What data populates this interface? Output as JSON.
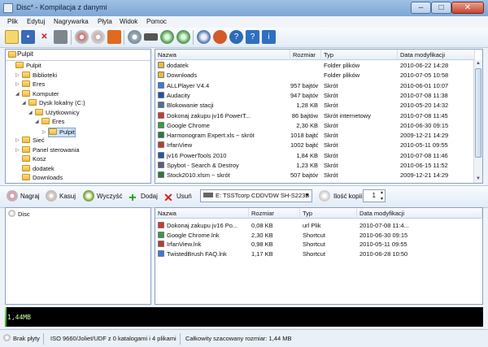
{
  "window": {
    "title": "Disc* - Kompilacja z danymi",
    "buttons": {
      "minimize": "–",
      "maximize": "□",
      "close": "✕"
    }
  },
  "menu": [
    "Plik",
    "Edytuj",
    "Nagrywarka",
    "Płyta",
    "Widok",
    "Pomoc"
  ],
  "toolbar": {
    "icons": [
      "new-icon",
      "save-icon",
      "delete-icon",
      "print-icon",
      "burn-icon",
      "copy-icon",
      "disc-icon",
      "drive-icon",
      "erase-icon",
      "disc2-icon",
      "settings-icon",
      "paint-icon",
      "help-circle-icon",
      "help-icon",
      "info-icon"
    ]
  },
  "tree": {
    "header": "Pulpit",
    "items": [
      {
        "label": "Pulpit",
        "exp": ""
      },
      {
        "label": "Biblioteki",
        "exp": "▷"
      },
      {
        "label": "Eres",
        "exp": "▷"
      },
      {
        "label": "Komputer",
        "exp": "◢"
      },
      {
        "label": "Dysk lokalny (C:)",
        "exp": "◢"
      },
      {
        "label": "Użytkownicy",
        "exp": "◢"
      },
      {
        "label": "Eres",
        "exp": "◢"
      },
      {
        "label": "Pulpit",
        "exp": "▷"
      },
      {
        "label": "Sieć",
        "exp": "▷"
      },
      {
        "label": "Panel sterowania",
        "exp": "▷"
      },
      {
        "label": "Kosz",
        "exp": ""
      },
      {
        "label": "dodatek",
        "exp": ""
      },
      {
        "label": "Downloads",
        "exp": ""
      }
    ]
  },
  "files": {
    "headers": {
      "name": "Nazwa",
      "size": "Rozmiar",
      "type": "Typ",
      "date": "Data modyfikacji"
    },
    "rows": [
      {
        "name": "dodatek",
        "size": "",
        "type": "Folder plików",
        "date": "2010-06-22 14:28",
        "color": "#f0b93e"
      },
      {
        "name": "Downloads",
        "size": "",
        "type": "Folder plików",
        "date": "2010-07-05 10:58",
        "color": "#f0b93e"
      },
      {
        "name": "ALLPlayer V4.4",
        "size": "957 bajtów",
        "type": "Skrót",
        "date": "2010-06-01 10:07",
        "color": "#3a7bd5"
      },
      {
        "name": "Audacity",
        "size": "947 bajtów",
        "type": "Skrót",
        "date": "2010-07-08 11:38",
        "color": "#1e50b0"
      },
      {
        "name": "Blokowanie stacji",
        "size": "1,28 KB",
        "type": "Skrót",
        "date": "2010-05-20 14:32",
        "color": "#4a6fa0"
      },
      {
        "name": "Dokonaj zakupu jv16 PowerT...",
        "size": "86 bajtów",
        "type": "Skrót internetowy",
        "date": "2010-07-08 11:45",
        "color": "#d03a2a"
      },
      {
        "name": "Google Chrome",
        "size": "2,30 KB",
        "type": "Skrót",
        "date": "2010-06-30 09:15",
        "color": "#2f9e44"
      },
      {
        "name": "Harmonogram Expert.xls ~ skrót",
        "size": "1018 bajtów",
        "type": "Skrót",
        "date": "2009-12-21 14:29",
        "color": "#2a7a3a"
      },
      {
        "name": "IrfanView",
        "size": "1002 bajtów",
        "type": "Skrót",
        "date": "2010-05-11 09:55",
        "color": "#c0392b"
      },
      {
        "name": "jv16 PowerTools 2010",
        "size": "1,84 KB",
        "type": "Skrót",
        "date": "2010-07-08 11:46",
        "color": "#1f5aa6"
      },
      {
        "name": "Spybot - Search & Destroy",
        "size": "1,23 KB",
        "type": "Skrót",
        "date": "2010-06-15 11:52",
        "color": "#5a5a8a"
      },
      {
        "name": "Stock2010.xlsm ~ skrót",
        "size": "507 bajtów",
        "type": "Skrót",
        "date": "2009-12-21 14:29",
        "color": "#2a7a3a"
      }
    ]
  },
  "actions": {
    "burn": "Nagraj",
    "erase": "Kasuj",
    "clear": "Wyczyść",
    "add": "Dodaj",
    "remove": "Usuń",
    "drive": "E: TSSTcorp CDDVDW SH-S223B",
    "copies_label": "Ilość kopii:",
    "copies_value": "1"
  },
  "disc_tree": {
    "root": "Disc"
  },
  "compilation": {
    "headers": {
      "name": "Nazwa",
      "size": "Rozmiar",
      "type": "Typ",
      "date": "Data modyfikacji"
    },
    "rows": [
      {
        "name": "Dokonaj zakupu jv16 Po...",
        "size": "0,08 KB",
        "type": "url Plik",
        "date": "2010-07-08 11:4...",
        "color": "#d03a2a"
      },
      {
        "name": "Google Chrome.lnk",
        "size": "2,30 KB",
        "type": "Shortcut",
        "date": "2010-06-30 09:15",
        "color": "#2f9e44"
      },
      {
        "name": "IrfanView.lnk",
        "size": "0,98 KB",
        "type": "Shortcut",
        "date": "2010-05-11 09:55",
        "color": "#c0392b"
      },
      {
        "name": "TwistedBrush FAQ.lnk",
        "size": "1,17 KB",
        "type": "Shortcut",
        "date": "2010-06-28 10:50",
        "color": "#3a7bd5"
      }
    ]
  },
  "capacity": {
    "label": "1,44MB",
    "fraction": 0.004
  },
  "status": {
    "disc": "Brak płyty",
    "fs": "ISO 9660/Joliet/UDF z 0 katalogami i 4 plikami",
    "total": "Całkowity szacowany rozmiar: 1,44 MB"
  },
  "colors": {
    "accent": "#3d9e1e",
    "selection": "#cfe3fb"
  }
}
